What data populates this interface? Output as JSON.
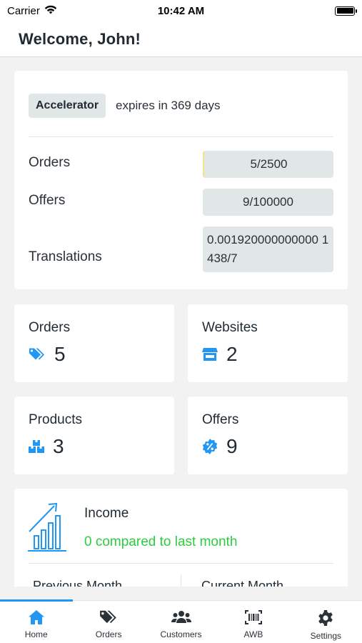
{
  "status_bar": {
    "carrier": "Carrier",
    "time": "10:42 AM"
  },
  "header": {
    "title": "Welcome, John!"
  },
  "plan": {
    "name": "Accelerator",
    "expiry": "expires in 369 days",
    "usage": [
      {
        "label": "Orders",
        "value": "5/2500"
      },
      {
        "label": "Offers",
        "value": "9/100000"
      },
      {
        "label": "Translations",
        "value": "0.001920000000000 1438/7"
      }
    ]
  },
  "stats": [
    {
      "title": "Orders",
      "value": "5",
      "icon": "tag-icon"
    },
    {
      "title": "Websites",
      "value": "2",
      "icon": "store-icon"
    },
    {
      "title": "Products",
      "value": "3",
      "icon": "boxes-icon"
    },
    {
      "title": "Offers",
      "value": "9",
      "icon": "percent-badge-icon"
    }
  ],
  "income": {
    "title": "Income",
    "comparison": "0 compared to last month",
    "previous_label": "Previous Month",
    "current_label": "Current Month",
    "icon": "growth-chart-icon"
  },
  "tabs": [
    {
      "label": "Home",
      "icon": "home-icon",
      "active": true
    },
    {
      "label": "Orders",
      "icon": "tags-icon",
      "active": false
    },
    {
      "label": "Customers",
      "icon": "users-icon",
      "active": false
    },
    {
      "label": "AWB",
      "icon": "barcode-icon",
      "active": false
    },
    {
      "label": "Settings",
      "icon": "gear-icon",
      "active": false
    }
  ],
  "colors": {
    "accent": "#2196f3",
    "positive": "#2ecc40",
    "badge_bg": "#e1e6e6",
    "page_bg": "#f2f2f2"
  }
}
